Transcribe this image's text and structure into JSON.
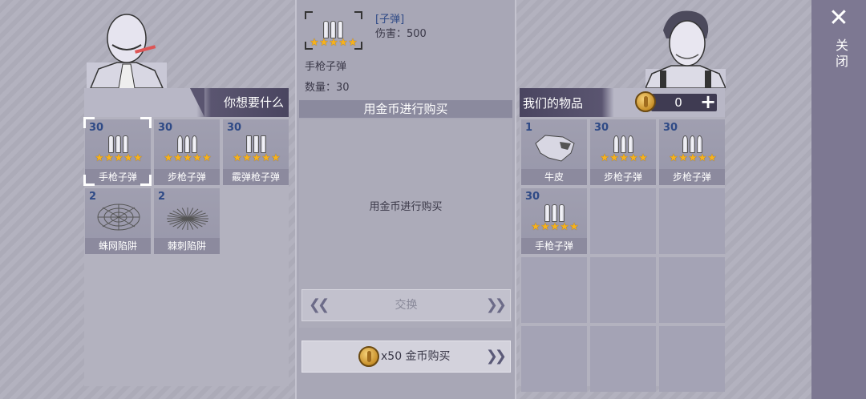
{
  "left": {
    "title": "你想要什么",
    "items": [
      {
        "qty": "30",
        "label": "手枪子弹",
        "icon": "pistol-ammo-icon",
        "stars": 5
      },
      {
        "qty": "30",
        "label": "步枪子弹",
        "icon": "rifle-ammo-icon",
        "stars": 5
      },
      {
        "qty": "30",
        "label": "霰弹枪子弹",
        "icon": "shotgun-ammo-icon",
        "stars": 5
      },
      {
        "qty": "2",
        "label": "蛛网陷阱",
        "icon": "web-trap-icon",
        "stars": 0
      },
      {
        "qty": "2",
        "label": "棘刺陷阱",
        "icon": "spike-trap-icon",
        "stars": 0
      }
    ]
  },
  "detail": {
    "type": "[子弹]",
    "damage": "伤害：500",
    "name": "手枪子弹",
    "count": "数量：30"
  },
  "center": {
    "title": "用金币进行购买",
    "message": "用金币进行购买",
    "exchange_label": "交换",
    "buy_label": "x50 金币购买"
  },
  "right": {
    "title": "我们的物品",
    "coins": "0",
    "items": [
      {
        "qty": "1",
        "label": "牛皮",
        "icon": "cowhide-icon",
        "stars": 0
      },
      {
        "qty": "30",
        "label": "步枪子弹",
        "icon": "rifle-ammo-icon",
        "stars": 5
      },
      {
        "qty": "30",
        "label": "步枪子弹",
        "icon": "rifle-ammo-icon",
        "stars": 5
      },
      {
        "qty": "30",
        "label": "手枪子弹",
        "icon": "pistol-ammo-icon",
        "stars": 5
      }
    ]
  },
  "close": {
    "label": "关闭"
  },
  "colors": {
    "accent": "#4a4560",
    "star": "#f7b21c",
    "qty": "#2f4a86"
  }
}
